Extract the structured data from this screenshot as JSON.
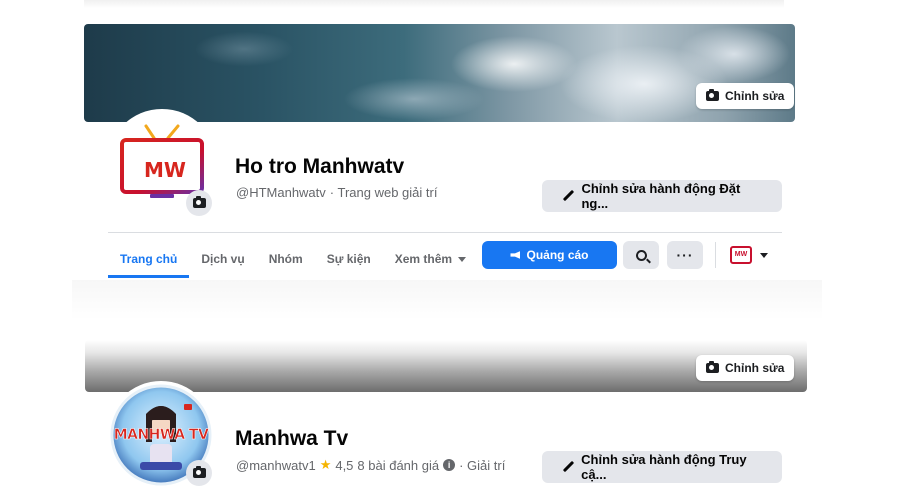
{
  "page1": {
    "cover_edit_label": "Chỉnh sửa",
    "name": "Ho tro Manhwatv",
    "handle": "@HTManhwatv",
    "category": "· Trang web giải trí",
    "action_button_label": "Chỉnh sửa hành động Đặt ng...",
    "logo_text": "MW",
    "tabs": [
      {
        "label": "Trang chủ",
        "active": true
      },
      {
        "label": "Dịch vụ",
        "active": false
      },
      {
        "label": "Nhóm",
        "active": false
      },
      {
        "label": "Sự kiện",
        "active": false
      },
      {
        "label": "Xem thêm",
        "active": false
      }
    ],
    "ad_button_label": "Quảng cáo",
    "more_button_label": "···",
    "switcher_logo_text": "MW"
  },
  "page2": {
    "cover_edit_label": "Chỉnh sửa",
    "name": "Manhwa Tv",
    "handle": "@manhwatv1",
    "rating": "4,5",
    "reviews": "8 bài đánh giá",
    "category": "· Giải trí",
    "action_button_label": "Chỉnh sửa hành động Truy cậ...",
    "logo_text": "MANHWA TV"
  },
  "colors": {
    "brand_blue": "#1877f2",
    "button_grey": "#e4e6eb",
    "logo_red": "#c8102e"
  }
}
